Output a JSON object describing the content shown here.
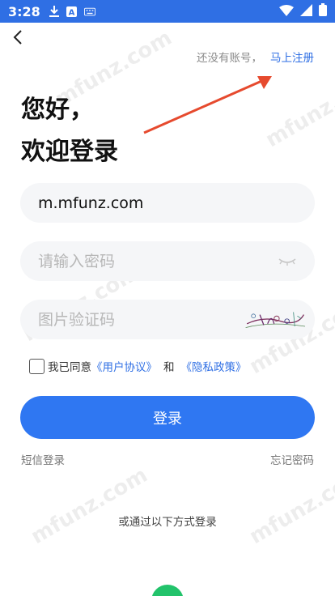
{
  "status_bar": {
    "time": "3:28",
    "icons": [
      "download-icon",
      "app-a-icon",
      "keyboard-icon"
    ],
    "right_icons": [
      "wifi-icon",
      "signal-icon",
      "battery-icon"
    ]
  },
  "header": {
    "back_icon": "chevron-left-icon",
    "no_account_text": "还没有账号，",
    "register_link": "马上注册"
  },
  "headline": {
    "line1": "您好，",
    "line2": "欢迎登录"
  },
  "form": {
    "account_value": "m.mfunz.com",
    "password_placeholder": "请输入密码",
    "captcha_placeholder": "图片验证码"
  },
  "agreement": {
    "prefix": "我已同意",
    "user_agreement": "《用户协议》",
    "and": "和",
    "privacy_policy": "《隐私政策》"
  },
  "buttons": {
    "login": "登录",
    "sms_login": "短信登录",
    "forgot_password": "忘记密码"
  },
  "other_login_text": "或通过以下方式登录",
  "watermark": "mfunz.com",
  "colors": {
    "accent": "#2f77f2",
    "status_bar": "#2f6fe4",
    "annotation_arrow": "#e64a2e"
  }
}
